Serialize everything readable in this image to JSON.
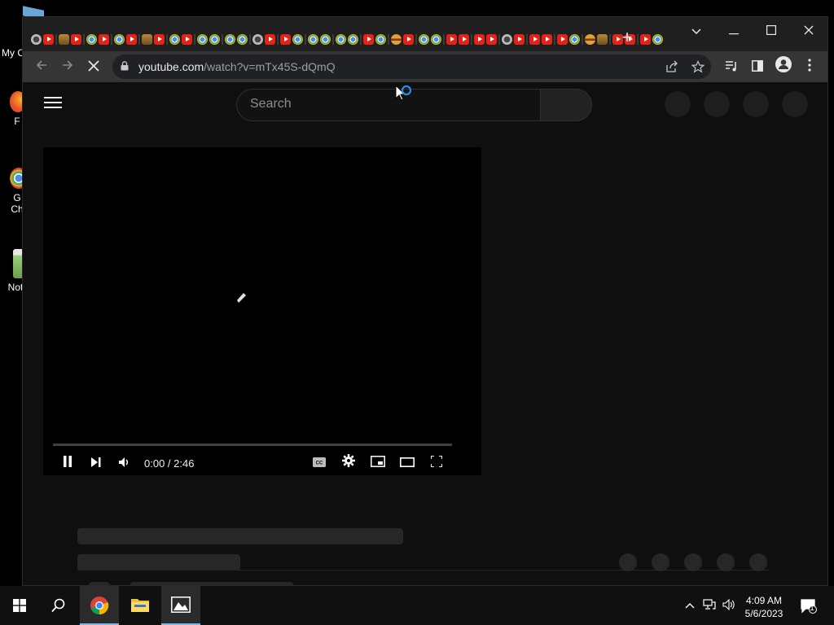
{
  "desktop": {
    "icons": [
      {
        "label": "My C",
        "name": "desktop-icon-my-computer",
        "color": "#6aa6d8"
      },
      {
        "label": "F",
        "name": "desktop-icon-firefox",
        "color": "#e5512c"
      },
      {
        "label": "G\nCh",
        "name": "desktop-icon-google-chrome",
        "color": "#db4437"
      },
      {
        "label": "Not",
        "name": "desktop-icon-notepad",
        "color": "#9ad27a"
      }
    ]
  },
  "browser": {
    "tabs": [
      "gh",
      "yt",
      "pic",
      "yt",
      "chrome",
      "yt",
      "chrome",
      "yt",
      "pic",
      "yt",
      "chrome",
      "yt",
      "chrome",
      "chrome",
      "chrome",
      "chrome",
      "gh",
      "yt",
      "yt",
      "chrome",
      "chrome",
      "chrome",
      "chrome",
      "chrome",
      "yt",
      "chrome",
      "burger",
      "yt",
      "chrome",
      "chrome",
      "yt",
      "yt",
      "yt",
      "yt",
      "gh",
      "yt",
      "yt",
      "yt",
      "yt",
      "chrome",
      "burger",
      "pic",
      "yt",
      "yt",
      "yt",
      "chrome"
    ],
    "new_tab_icon": "plus-icon",
    "address": {
      "host": "youtube.com",
      "path": "/watch?v=mTx45S-dQmQ"
    }
  },
  "youtube": {
    "search_placeholder": "Search",
    "player": {
      "time_display": "0:00 / 2:46",
      "progress": 0.0
    }
  },
  "taskbar": {
    "time": "4:09 AM",
    "date": "5/6/2023",
    "notification_count": "1"
  },
  "colors": {
    "youtube_red": "#ff0000",
    "page_bg": "#0f0f0f",
    "toolbar_bg": "#353535",
    "taskbar_accent": "#76b9ed"
  }
}
